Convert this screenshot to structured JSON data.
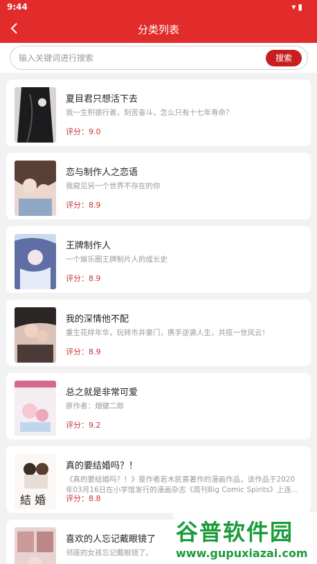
{
  "status": {
    "time": "9:44",
    "icons": "▾▮"
  },
  "header": {
    "title": "分类列表"
  },
  "search": {
    "placeholder": "输入关键词进行搜索",
    "button_label": "搜索"
  },
  "items": [
    {
      "title": "夏目君只想活下去",
      "desc": "我一生积德行善，刻苦奋斗，怎么只有十七年寿命？",
      "score": "评分：9.0"
    },
    {
      "title": "恋与制作人之恋语",
      "desc": "我窥见另一个世界不存在的你",
      "score": "评分：8.9"
    },
    {
      "title": "王牌制作人",
      "desc": "一个娱乐圈王牌制片人的成长史",
      "score": "评分：8.9"
    },
    {
      "title": "我的深情他不配",
      "desc": "重生花样年华，玩转市井豪门，携手逆袭人生，共揽一世风云！",
      "score": "评分：8.9"
    },
    {
      "title": "总之就是非常可爱",
      "desc": "原作者：畑健二郎",
      "score": "评分：9.2"
    },
    {
      "title": "真的要结婚吗？！",
      "desc": "《真的要结婚吗？！》是作者若木民喜著作的漫画作品，该作品于2020年03月16日在小学馆发行的漫画杂志《周刊Big Comic Spirits》上连...",
      "score": "评分：8.8"
    },
    {
      "title": "喜欢的人忘记戴眼镜了",
      "desc": "邻座的女孩忘记戴眼镜了。",
      "score": ""
    }
  ],
  "watermark": {
    "brand": "谷普软件园",
    "url": "www.gupuxiazai.com"
  },
  "colors": {
    "accent": "#e22b2b",
    "button": "#c81e1e",
    "score": "#c83232"
  }
}
